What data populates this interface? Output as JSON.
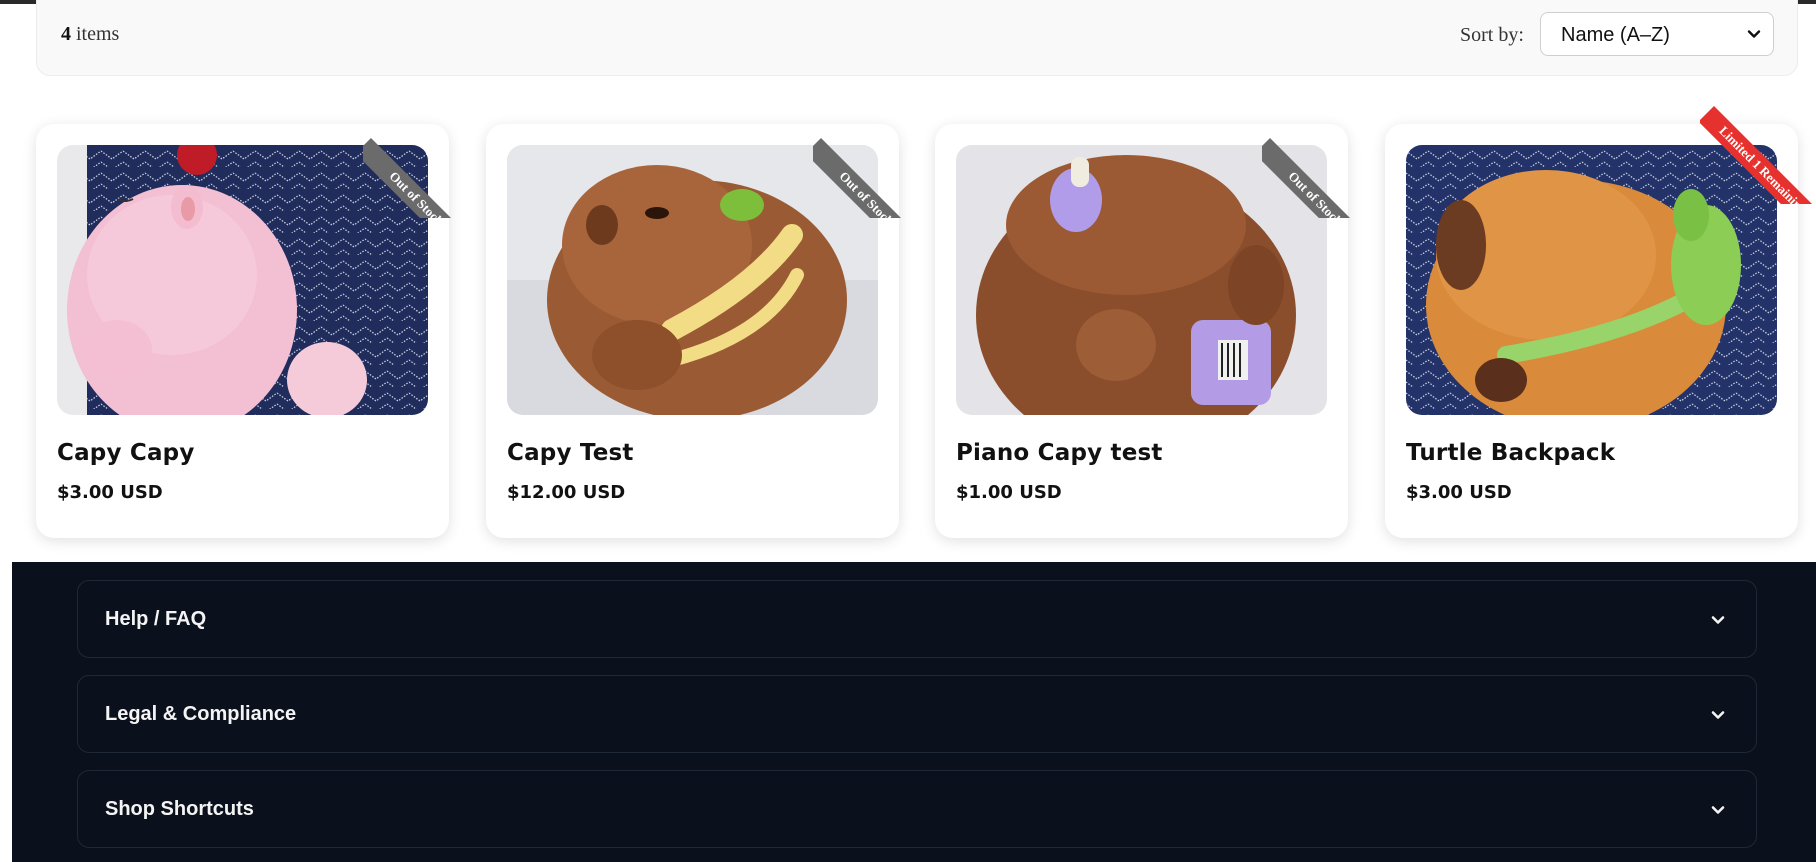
{
  "toolbar": {
    "count_number": "4",
    "count_label": "items",
    "sort_label": "Sort by:",
    "sort_value": "Name (A–Z)"
  },
  "products": [
    {
      "name": "Capy Capy",
      "price": "$3.00 USD",
      "badge": "Out of Stock",
      "badge_color": "#6b6b6b"
    },
    {
      "name": "Capy Test",
      "price": "$12.00 USD",
      "badge": "Out of Stock",
      "badge_color": "#6b6b6b"
    },
    {
      "name": "Piano Capy test",
      "price": "$1.00 USD",
      "badge": "Out of Stock",
      "badge_color": "#6b6b6b"
    },
    {
      "name": "Turtle Backpack",
      "price": "$3.00 USD",
      "badge": "Limited 1 Remaining",
      "badge_color": "#e6322e"
    }
  ],
  "footer": {
    "sections": [
      {
        "title": "Help / FAQ",
        "icon": "chevron-down-icon"
      },
      {
        "title": "Legal & Compliance",
        "icon": "chevron-down-icon"
      },
      {
        "title": "Shop Shortcuts",
        "icon": "chevron-down-icon"
      }
    ]
  },
  "colors": {
    "footer_bg": "#0b111c",
    "out_of_stock_badge": "#6b6b6b",
    "limited_badge": "#e6322e"
  }
}
